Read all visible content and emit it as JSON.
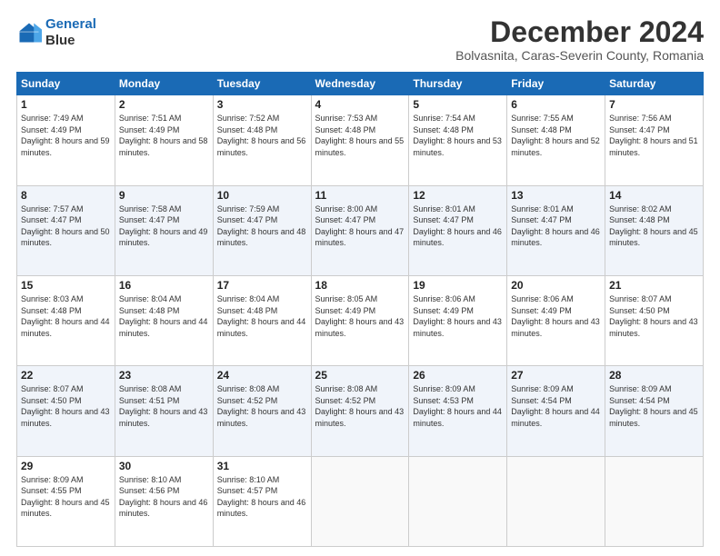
{
  "logo": {
    "line1": "General",
    "line2": "Blue"
  },
  "title": "December 2024",
  "subtitle": "Bolvasnita, Caras-Severin County, Romania",
  "days_of_week": [
    "Sunday",
    "Monday",
    "Tuesday",
    "Wednesday",
    "Thursday",
    "Friday",
    "Saturday"
  ],
  "weeks": [
    [
      {
        "day": 1,
        "sunrise": "7:49 AM",
        "sunset": "4:49 PM",
        "daylight": "8 hours and 59 minutes."
      },
      {
        "day": 2,
        "sunrise": "7:51 AM",
        "sunset": "4:49 PM",
        "daylight": "8 hours and 58 minutes."
      },
      {
        "day": 3,
        "sunrise": "7:52 AM",
        "sunset": "4:48 PM",
        "daylight": "8 hours and 56 minutes."
      },
      {
        "day": 4,
        "sunrise": "7:53 AM",
        "sunset": "4:48 PM",
        "daylight": "8 hours and 55 minutes."
      },
      {
        "day": 5,
        "sunrise": "7:54 AM",
        "sunset": "4:48 PM",
        "daylight": "8 hours and 53 minutes."
      },
      {
        "day": 6,
        "sunrise": "7:55 AM",
        "sunset": "4:48 PM",
        "daylight": "8 hours and 52 minutes."
      },
      {
        "day": 7,
        "sunrise": "7:56 AM",
        "sunset": "4:47 PM",
        "daylight": "8 hours and 51 minutes."
      }
    ],
    [
      {
        "day": 8,
        "sunrise": "7:57 AM",
        "sunset": "4:47 PM",
        "daylight": "8 hours and 50 minutes."
      },
      {
        "day": 9,
        "sunrise": "7:58 AM",
        "sunset": "4:47 PM",
        "daylight": "8 hours and 49 minutes."
      },
      {
        "day": 10,
        "sunrise": "7:59 AM",
        "sunset": "4:47 PM",
        "daylight": "8 hours and 48 minutes."
      },
      {
        "day": 11,
        "sunrise": "8:00 AM",
        "sunset": "4:47 PM",
        "daylight": "8 hours and 47 minutes."
      },
      {
        "day": 12,
        "sunrise": "8:01 AM",
        "sunset": "4:47 PM",
        "daylight": "8 hours and 46 minutes."
      },
      {
        "day": 13,
        "sunrise": "8:01 AM",
        "sunset": "4:47 PM",
        "daylight": "8 hours and 46 minutes."
      },
      {
        "day": 14,
        "sunrise": "8:02 AM",
        "sunset": "4:48 PM",
        "daylight": "8 hours and 45 minutes."
      }
    ],
    [
      {
        "day": 15,
        "sunrise": "8:03 AM",
        "sunset": "4:48 PM",
        "daylight": "8 hours and 44 minutes."
      },
      {
        "day": 16,
        "sunrise": "8:04 AM",
        "sunset": "4:48 PM",
        "daylight": "8 hours and 44 minutes."
      },
      {
        "day": 17,
        "sunrise": "8:04 AM",
        "sunset": "4:48 PM",
        "daylight": "8 hours and 44 minutes."
      },
      {
        "day": 18,
        "sunrise": "8:05 AM",
        "sunset": "4:49 PM",
        "daylight": "8 hours and 43 minutes."
      },
      {
        "day": 19,
        "sunrise": "8:06 AM",
        "sunset": "4:49 PM",
        "daylight": "8 hours and 43 minutes."
      },
      {
        "day": 20,
        "sunrise": "8:06 AM",
        "sunset": "4:49 PM",
        "daylight": "8 hours and 43 minutes."
      },
      {
        "day": 21,
        "sunrise": "8:07 AM",
        "sunset": "4:50 PM",
        "daylight": "8 hours and 43 minutes."
      }
    ],
    [
      {
        "day": 22,
        "sunrise": "8:07 AM",
        "sunset": "4:50 PM",
        "daylight": "8 hours and 43 minutes."
      },
      {
        "day": 23,
        "sunrise": "8:08 AM",
        "sunset": "4:51 PM",
        "daylight": "8 hours and 43 minutes."
      },
      {
        "day": 24,
        "sunrise": "8:08 AM",
        "sunset": "4:52 PM",
        "daylight": "8 hours and 43 minutes."
      },
      {
        "day": 25,
        "sunrise": "8:08 AM",
        "sunset": "4:52 PM",
        "daylight": "8 hours and 43 minutes."
      },
      {
        "day": 26,
        "sunrise": "8:09 AM",
        "sunset": "4:53 PM",
        "daylight": "8 hours and 44 minutes."
      },
      {
        "day": 27,
        "sunrise": "8:09 AM",
        "sunset": "4:54 PM",
        "daylight": "8 hours and 44 minutes."
      },
      {
        "day": 28,
        "sunrise": "8:09 AM",
        "sunset": "4:54 PM",
        "daylight": "8 hours and 45 minutes."
      }
    ],
    [
      {
        "day": 29,
        "sunrise": "8:09 AM",
        "sunset": "4:55 PM",
        "daylight": "8 hours and 45 minutes."
      },
      {
        "day": 30,
        "sunrise": "8:10 AM",
        "sunset": "4:56 PM",
        "daylight": "8 hours and 46 minutes."
      },
      {
        "day": 31,
        "sunrise": "8:10 AM",
        "sunset": "4:57 PM",
        "daylight": "8 hours and 46 minutes."
      },
      null,
      null,
      null,
      null
    ]
  ]
}
